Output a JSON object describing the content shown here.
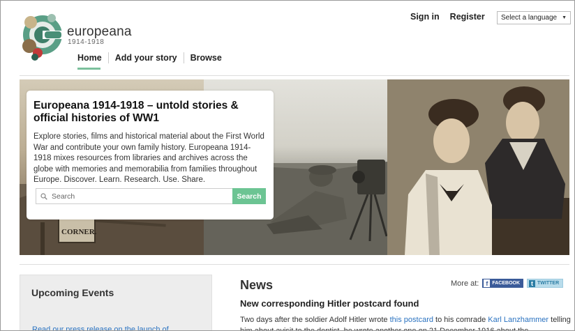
{
  "header": {
    "brand_name": "europeana",
    "brand_years": "1914-1918",
    "nav": [
      {
        "label": "Home"
      },
      {
        "label": "Add your story"
      },
      {
        "label": "Browse"
      }
    ],
    "sign_in": "Sign in",
    "register": "Register",
    "language_select": "Select a language"
  },
  "hero": {
    "title": "Europeana 1914-1918 – untold stories & official histories of WW1",
    "text": "Explore stories, films and historical material about the First World War and contribute your own family history. Europeana 1914-1918 mixes resources from libraries and archives across the globe with memories and memorabilia from families throughout Europe. Discover. Learn. Research. Use. Share.",
    "search_placeholder": "Search",
    "search_button": "Search",
    "sign_text": "CORNER."
  },
  "events": {
    "title": "Upcoming Events",
    "link": "Read our press release on the launch of"
  },
  "news": {
    "title": "News",
    "more_at": "More at:",
    "facebook": "FACEBOOK",
    "twitter": "TWITTER",
    "headline": "New corresponding Hitler postcard found",
    "p1": "Two days after the soldier Adolf Hitler wrote ",
    "link1": "this postcard",
    "p2": " to his comrade ",
    "link2": "Karl Lanzhammer",
    "p3": " telling him about avisit to the dentist, he wrote another one on 21 December 1916 about the"
  },
  "colors": {
    "accent_green": "#6cc493",
    "link_blue": "#2a72c0",
    "facebook_blue": "#3b5b99"
  }
}
